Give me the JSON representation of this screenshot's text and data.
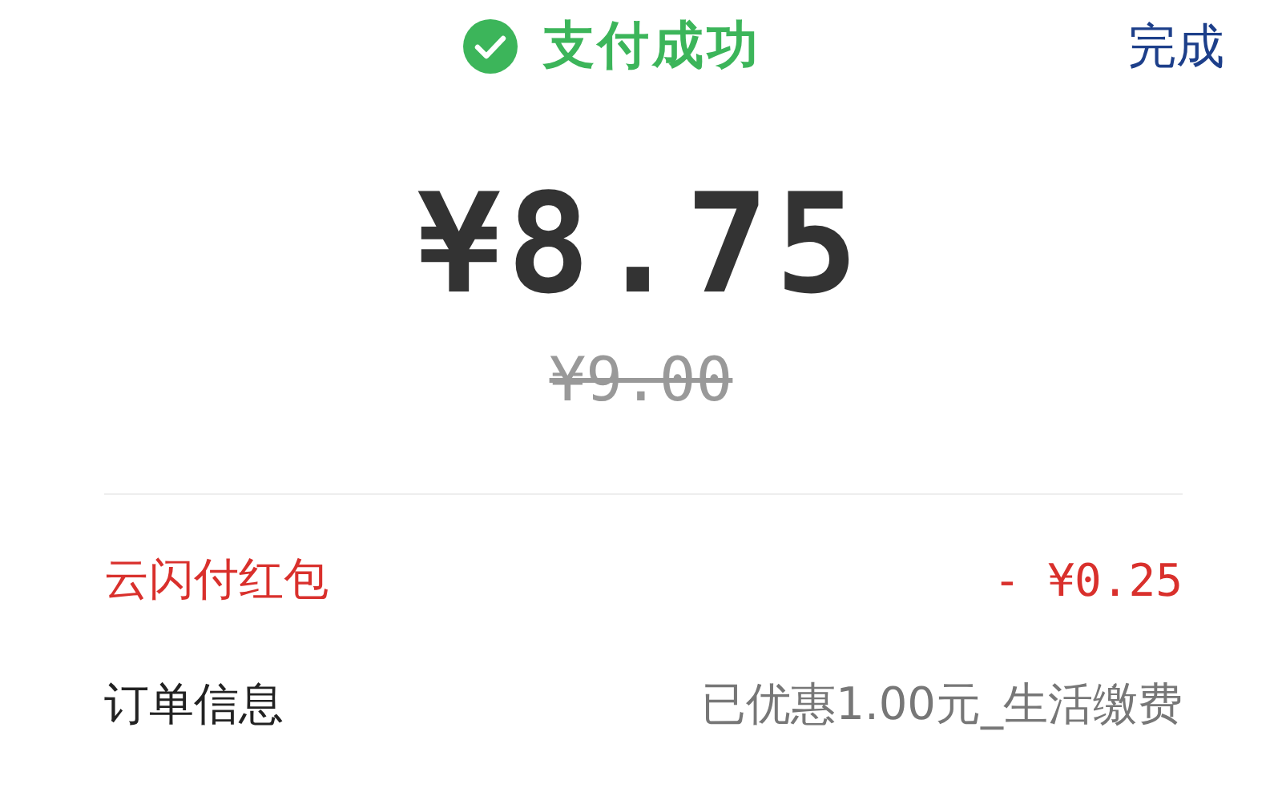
{
  "header": {
    "title": "支付成功",
    "done": "完成"
  },
  "amount": {
    "paid": "¥8.75",
    "original": "¥9.00"
  },
  "rows": [
    {
      "label": "云闪付红包",
      "value": "- ¥0.25",
      "kind": "discount"
    },
    {
      "label": "订单信息",
      "value": "已优惠1.00元_生活缴费",
      "kind": "info"
    }
  ]
}
